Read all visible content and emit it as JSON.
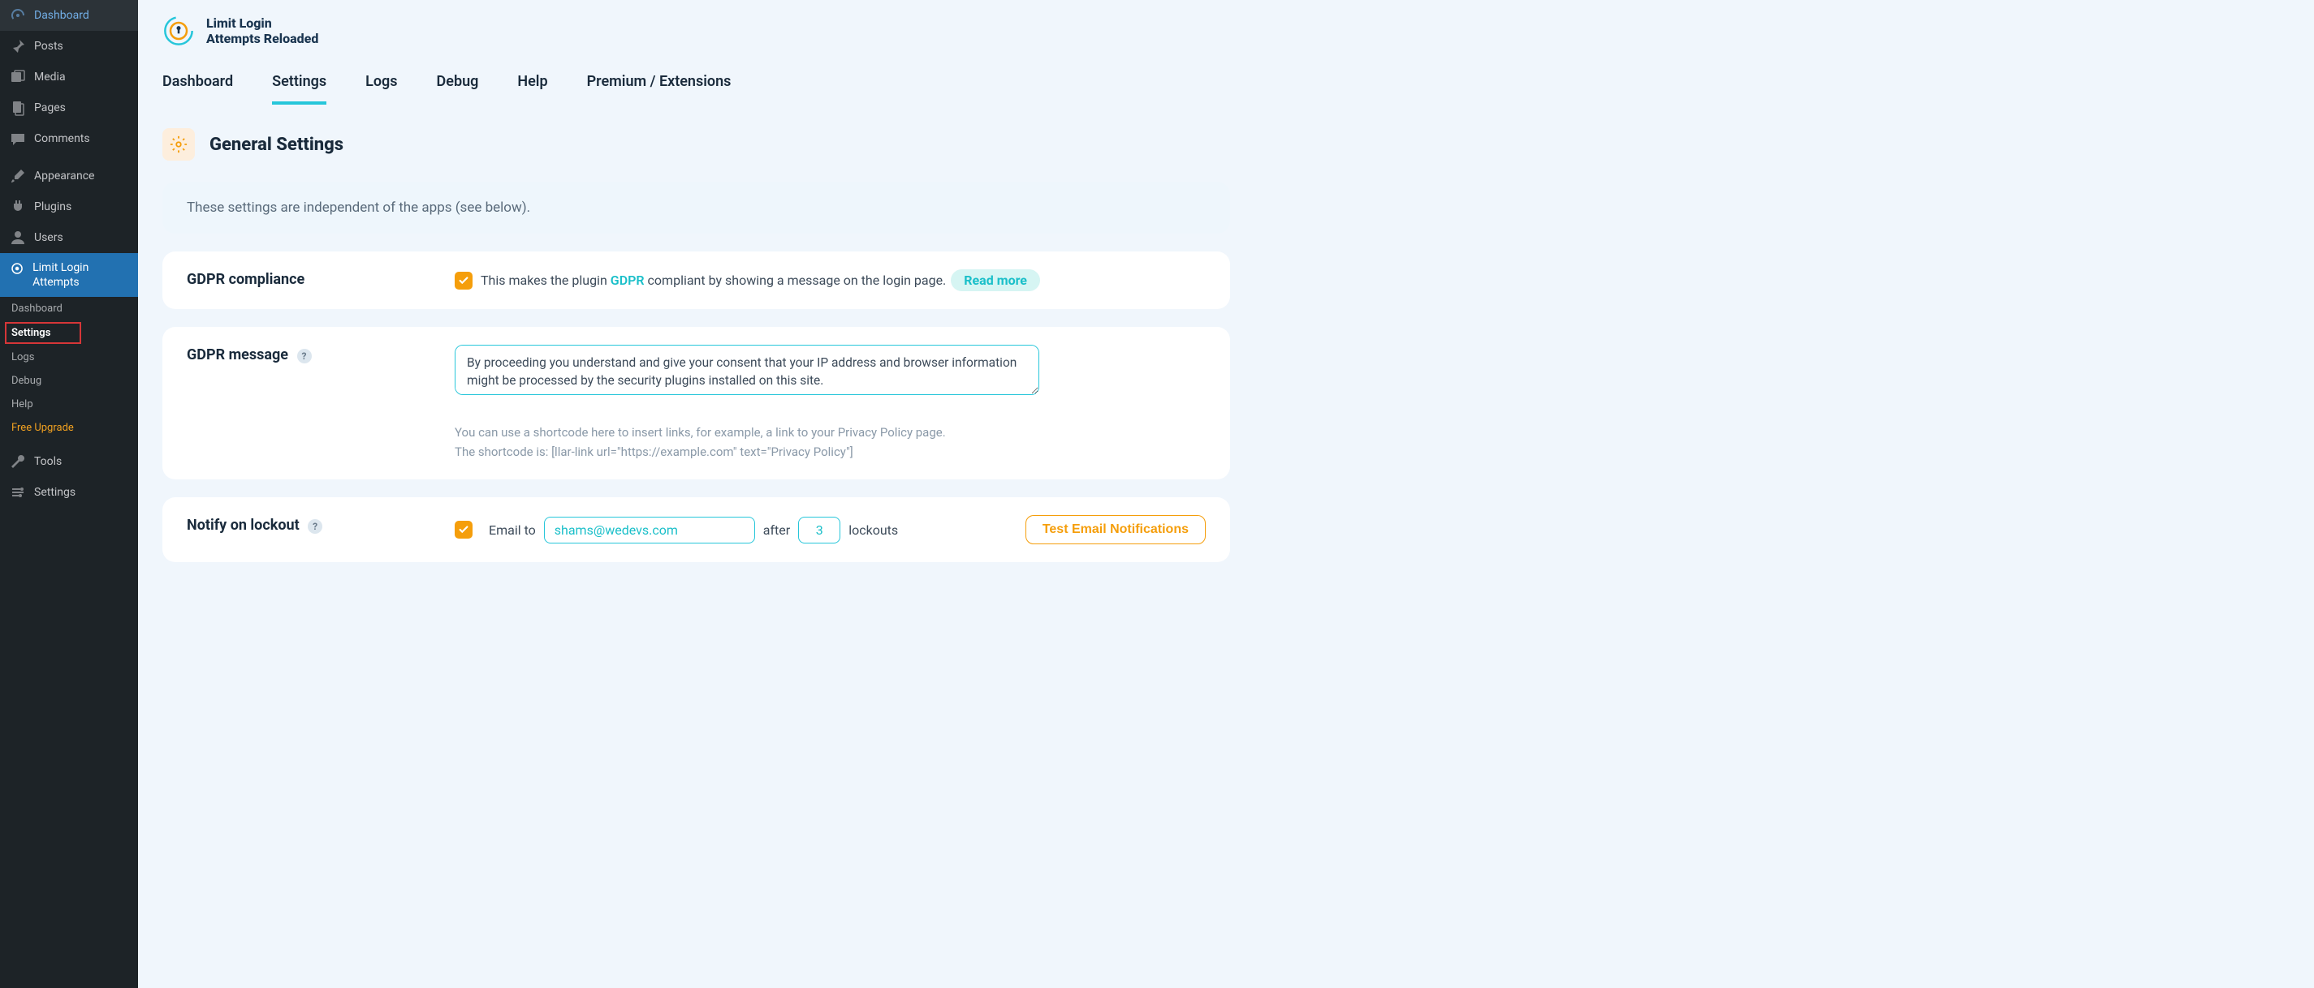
{
  "wp_menu": {
    "top": [
      {
        "label": "Dashboard",
        "icon": "dashboard"
      },
      {
        "label": "Posts",
        "icon": "pin"
      },
      {
        "label": "Media",
        "icon": "media"
      },
      {
        "label": "Pages",
        "icon": "pages"
      },
      {
        "label": "Comments",
        "icon": "comments"
      }
    ],
    "mid": [
      {
        "label": "Appearance",
        "icon": "brush"
      },
      {
        "label": "Plugins",
        "icon": "plug"
      },
      {
        "label": "Users",
        "icon": "user"
      }
    ],
    "active": {
      "label": "Limit Login Attempts",
      "icon": "llar"
    },
    "sub": [
      {
        "label": "Dashboard"
      },
      {
        "label": "Settings",
        "current": true,
        "highlighted": true
      },
      {
        "label": "Logs"
      },
      {
        "label": "Debug"
      },
      {
        "label": "Help"
      },
      {
        "label": "Free Upgrade",
        "upgrade": true
      }
    ],
    "bottom": [
      {
        "label": "Tools",
        "icon": "wrench"
      },
      {
        "label": "Settings",
        "icon": "sliders"
      }
    ]
  },
  "plugin": {
    "title_line1": "Limit Login",
    "title_line2": "Attempts Reloaded",
    "tabs": [
      "Dashboard",
      "Settings",
      "Logs",
      "Debug",
      "Help",
      "Premium / Extensions"
    ],
    "active_tab": "Settings",
    "section_heading": "General Settings",
    "info_text": "These settings are independent of the apps (see below).",
    "gdpr_compliance": {
      "label": "GDPR compliance",
      "checked": true,
      "desc_before": "This makes the plugin ",
      "desc_link": "GDPR",
      "desc_after": " compliant by showing a message on the login page.",
      "read_more": "Read more"
    },
    "gdpr_message": {
      "label": "GDPR message",
      "value": "By proceeding you understand and give your consent that your IP address and browser information might be processed by the security plugins installed on this site.",
      "hint1": "You can use a shortcode here to insert links, for example, a link to your Privacy Policy page.",
      "hint2": "The shortcode is: [llar-link url=\"https://example.com\" text=\"Privacy Policy\"]"
    },
    "notify": {
      "label": "Notify on lockout",
      "checked": true,
      "email_to_word": "Email to",
      "email": "shams@wedevs.com",
      "after_word": "after",
      "count": "3",
      "lockouts_word": "lockouts",
      "test_btn": "Test Email Notifications"
    }
  }
}
